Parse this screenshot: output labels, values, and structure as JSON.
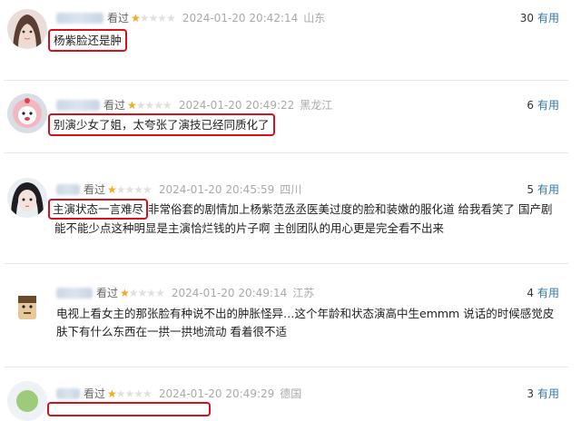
{
  "comments": [
    {
      "watched": "看过",
      "rating": 1,
      "time": "2024-01-20 20:42:14",
      "location": "山东",
      "useful_count": "30",
      "useful_label": "有用",
      "text": "杨紫脸还是肿",
      "extra": ""
    },
    {
      "watched": "看过",
      "rating": 1,
      "time": "2024-01-20 20:49:22",
      "location": "黑龙江",
      "useful_count": "6",
      "useful_label": "有用",
      "text": "别演少女了姐，太夸张了演技已经同质化了",
      "extra": ""
    },
    {
      "watched": "看过",
      "rating": 1,
      "time": "2024-01-20 20:45:59",
      "location": "四川",
      "useful_count": "5",
      "useful_label": "有用",
      "text": "主演状态一言难尽",
      "extra": "非常俗套的剧情加上杨紫范丞丞医美过度的脸和装嫩的服化道 给我看笑了 国产剧能不能少点这种明显是主演恰烂钱的片子啊 主创团队的用心更是完全看不出来"
    },
    {
      "watched": "看过",
      "rating": 1,
      "time": "2024-01-20 20:49:14",
      "location": "江苏",
      "useful_count": "4",
      "useful_label": "有用",
      "text": "电视上看女主的那张脸有种说不出的肿胀怪异…这个年龄和状态演高中生emmm 说话的时候感觉皮肤下有什么东西在一拱一拱地流动 看着很不适",
      "extra": ""
    },
    {
      "watched": "看过",
      "rating": 1,
      "time": "2024-01-20 20:49:29",
      "location": "德国",
      "useful_count": "3",
      "useful_label": "有用",
      "text": "",
      "extra": ""
    }
  ]
}
